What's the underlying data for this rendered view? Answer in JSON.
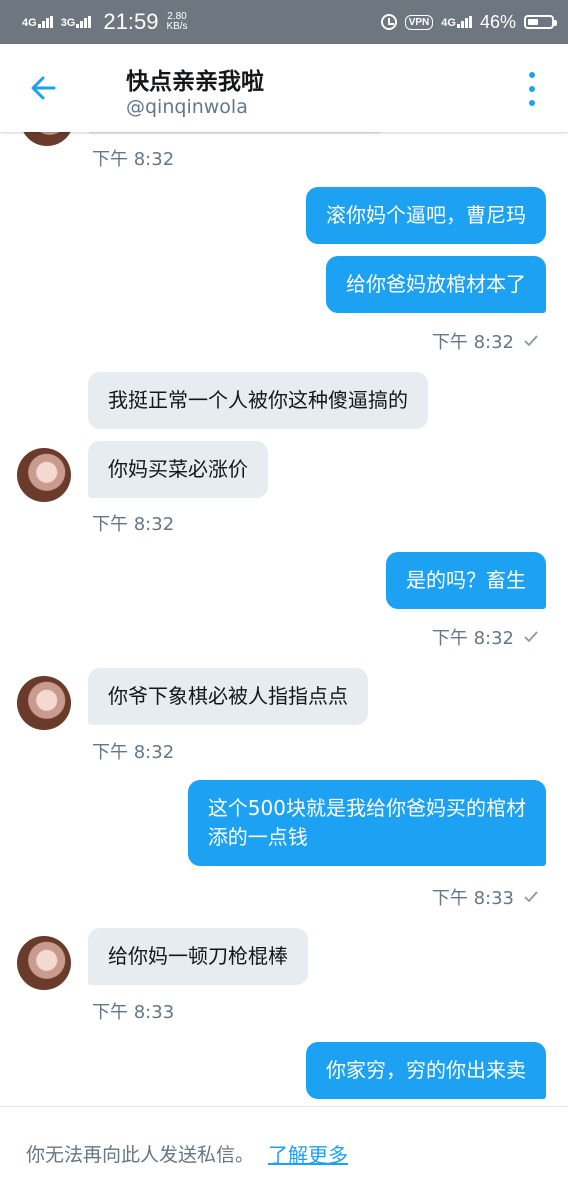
{
  "status_bar": {
    "net1": "4G",
    "net2": "3G",
    "time": "21:59",
    "speed_value": "2.80",
    "speed_unit": "KB/s",
    "vpn_label": "VPN",
    "net3": "4G",
    "battery_percent": "46%",
    "battery_level": 0.46,
    "icons": [
      "signal-icon",
      "alarm-icon",
      "battery-icon"
    ]
  },
  "header": {
    "title": "快点亲亲我啦",
    "handle": "@qinqinwola",
    "icons": [
      "back-arrow-icon",
      "more-options-icon"
    ],
    "accent_color": "#1da1f2"
  },
  "messages": [
    {
      "side": "received",
      "time": "下午 8:32"
    },
    {
      "side": "sent",
      "text": "滚你妈个逼吧，曹尼玛"
    },
    {
      "side": "sent",
      "text": "给你爸妈放棺材本了",
      "time": "下午 8:32"
    },
    {
      "side": "received",
      "text": "我挺正常一个人被你这种傻逼搞的"
    },
    {
      "side": "received",
      "text": "你妈买菜必涨价",
      "time": "下午 8:32"
    },
    {
      "side": "sent",
      "text": "是的吗？畜生",
      "time": "下午 8:32"
    },
    {
      "side": "received",
      "text": "你爷下象棋必被人指指点点",
      "time": "下午 8:32"
    },
    {
      "side": "sent",
      "text_line1": "这个500块就是我给你爸妈买的棺材",
      "text_line2": "添的一点钱",
      "time": "下午 8:33"
    },
    {
      "side": "received",
      "text": "给你妈一顿刀枪棍棒",
      "time": "下午 8:33"
    },
    {
      "side": "sent",
      "text": "你家穷，穷的你出来卖"
    }
  ],
  "footer": {
    "notice": "你无法再向此人发送私信。",
    "link": "了解更多"
  }
}
